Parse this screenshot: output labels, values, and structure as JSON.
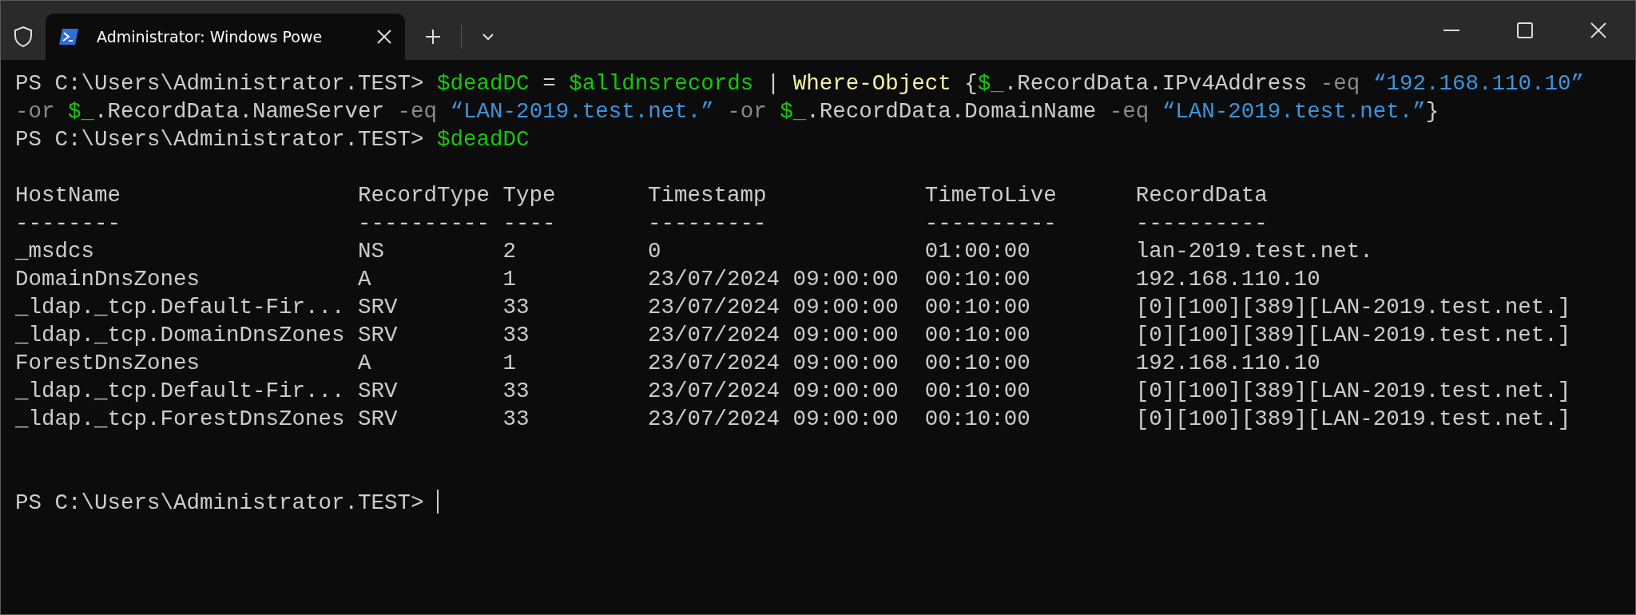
{
  "window": {
    "tabs": [
      {
        "title": "Administrator: Windows Powe",
        "selected": true
      }
    ]
  },
  "console": {
    "lines": [
      [
        {
          "kind": "plain",
          "text": "PS C:\\Users\\Administrator.TEST> "
        },
        {
          "kind": "var",
          "text": "$deadDC"
        },
        {
          "kind": "plain",
          "text": " = "
        },
        {
          "kind": "var",
          "text": "$alldnsrecords"
        },
        {
          "kind": "plain",
          "text": " | "
        },
        {
          "kind": "cmd",
          "text": "Where-Object"
        },
        {
          "kind": "plain",
          "text": " {"
        },
        {
          "kind": "var",
          "text": "$_"
        },
        {
          "kind": "plain",
          "text": ".RecordData.IPv4Address "
        },
        {
          "kind": "op",
          "text": "-eq "
        },
        {
          "kind": "str",
          "text": "“192.168.110.10”"
        }
      ],
      [
        {
          "kind": "op",
          "text": "-or "
        },
        {
          "kind": "var",
          "text": "$_"
        },
        {
          "kind": "plain",
          "text": ".RecordData.NameServer "
        },
        {
          "kind": "op",
          "text": "-eq "
        },
        {
          "kind": "str",
          "text": "“LAN-2019.test.net.”"
        },
        {
          "kind": "op",
          "text": " -or "
        },
        {
          "kind": "var",
          "text": "$_"
        },
        {
          "kind": "plain",
          "text": ".RecordData.DomainName "
        },
        {
          "kind": "op",
          "text": "-eq "
        },
        {
          "kind": "str",
          "text": "“LAN-2019.test.net.”"
        },
        {
          "kind": "plain",
          "text": "}"
        }
      ],
      [
        {
          "kind": "plain",
          "text": "PS C:\\Users\\Administrator.TEST> "
        },
        {
          "kind": "var",
          "text": "$deadDC"
        }
      ]
    ],
    "table": {
      "columns": [
        {
          "header": "HostName",
          "rule": "--------"
        },
        {
          "header": "RecordType",
          "rule": "----------"
        },
        {
          "header": "Type",
          "rule": "----"
        },
        {
          "header": "Timestamp",
          "rule": "---------"
        },
        {
          "header": "TimeToLive",
          "rule": "----------"
        },
        {
          "header": "RecordData",
          "rule": "----------"
        }
      ],
      "rows": [
        [
          "_msdcs",
          "NS",
          "2",
          "0",
          "01:00:00",
          "lan-2019.test.net."
        ],
        [
          "DomainDnsZones",
          "A",
          "1",
          "23/07/2024 09:00:00",
          "00:10:00",
          "192.168.110.10"
        ],
        [
          "_ldap._tcp.Default-Fir...",
          "SRV",
          "33",
          "23/07/2024 09:00:00",
          "00:10:00",
          "[0][100][389][LAN-2019.test.net.]"
        ],
        [
          "_ldap._tcp.DomainDnsZones",
          "SRV",
          "33",
          "23/07/2024 09:00:00",
          "00:10:00",
          "[0][100][389][LAN-2019.test.net.]"
        ],
        [
          "ForestDnsZones",
          "A",
          "1",
          "23/07/2024 09:00:00",
          "00:10:00",
          "192.168.110.10"
        ],
        [
          "_ldap._tcp.Default-Fir...",
          "SRV",
          "33",
          "23/07/2024 09:00:00",
          "00:10:00",
          "[0][100][389][LAN-2019.test.net.]"
        ],
        [
          "_ldap._tcp.ForestDnsZones",
          "SRV",
          "33",
          "23/07/2024 09:00:00",
          "00:10:00",
          "[0][100][389][LAN-2019.test.net.]"
        ]
      ]
    },
    "prompt": "PS C:\\Users\\Administrator.TEST>"
  }
}
